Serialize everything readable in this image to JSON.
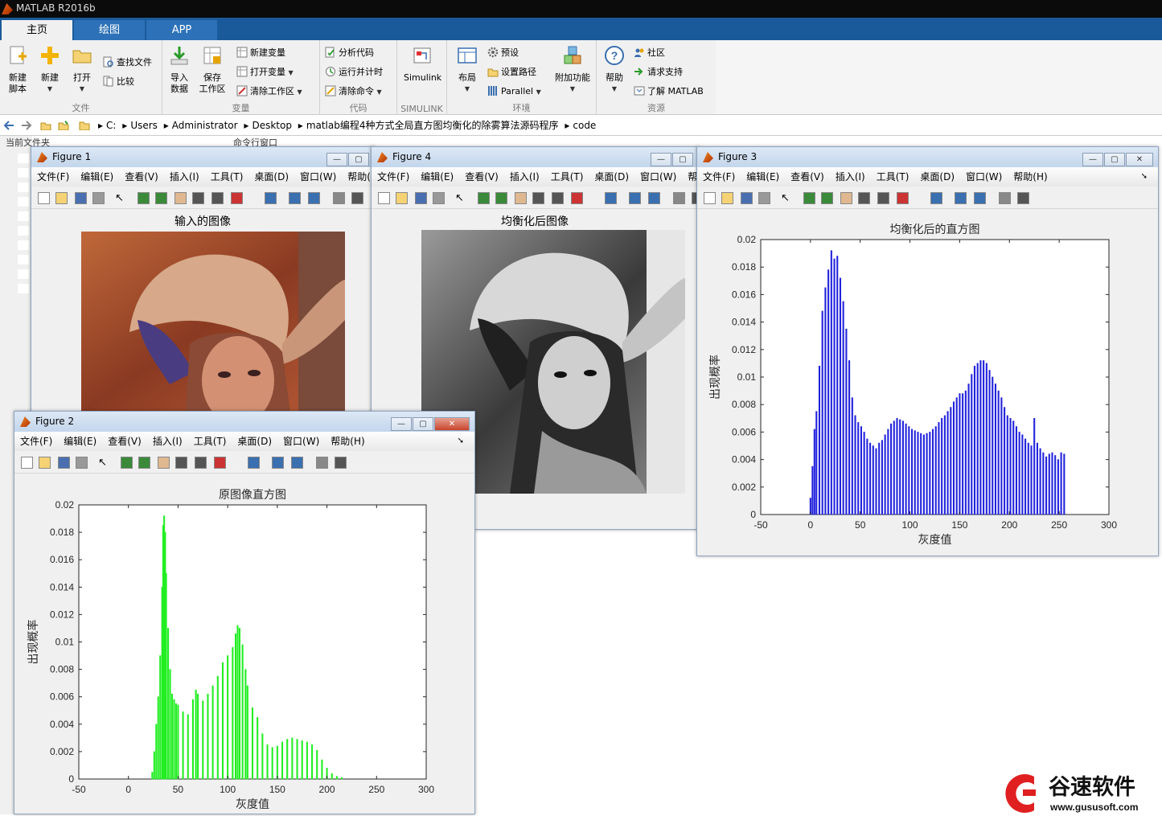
{
  "app": {
    "title": "MATLAB R2016b"
  },
  "tabs": [
    "主页",
    "绘图",
    "APP"
  ],
  "ribbon": {
    "file": {
      "label": "文件",
      "new_script": "新建\n脚本",
      "new": "新建",
      "open": "打开",
      "find_files": "查找文件",
      "compare": "比较"
    },
    "variable": {
      "label": "变量",
      "import": "导入\n数据",
      "save_ws": "保存\n工作区",
      "new_var": "新建变量",
      "open_var": "打开变量",
      "clear_ws": "清除工作区"
    },
    "code": {
      "label": "代码",
      "analyze": "分析代码",
      "run_time": "运行并计时",
      "clear_cmd": "清除命令"
    },
    "simulink": {
      "label": "SIMULINK",
      "simulink": "Simulink"
    },
    "env": {
      "label": "环境",
      "layout": "布局",
      "prefs": "预设",
      "set_path": "设置路径",
      "parallel": "Parallel",
      "addons": "附加功能"
    },
    "resources": {
      "label": "资源",
      "help": "帮助",
      "community": "社区",
      "support": "请求支持",
      "learn": "了解 MATLAB"
    }
  },
  "address": [
    "C:",
    "Users",
    "Administrator",
    "Desktop",
    "matlab编程4种方式全局直方图均衡化的除雾算法源码程序",
    "code"
  ],
  "panels": {
    "current_folder": "当前文件夹",
    "command_window": "命令行窗口"
  },
  "figure_menu": [
    "文件(F)",
    "编辑(E)",
    "查看(V)",
    "插入(I)",
    "工具(T)",
    "桌面(D)",
    "窗口(W)",
    "帮助(H)"
  ],
  "figures": {
    "fig1": {
      "title": "Figure 1",
      "plot_title": "输入的图像"
    },
    "fig4": {
      "title": "Figure 4",
      "plot_title": "均衡化后图像"
    },
    "fig3": {
      "title": "Figure 3",
      "plot_title": "均衡化后的直方图",
      "xlabel": "灰度值",
      "ylabel": "出现概率"
    },
    "fig2": {
      "title": "Figure 2",
      "plot_title": "原图像直方图",
      "xlabel": "灰度值",
      "ylabel": "出现概率"
    }
  },
  "watermark": {
    "name": "谷速软件",
    "url": "www.gususoft.com"
  },
  "chart_data": [
    {
      "type": "bar",
      "title": "原图像直方图",
      "xlabel": "灰度值",
      "ylabel": "出现概率",
      "xlim": [
        -50,
        300
      ],
      "ylim": [
        0,
        0.02
      ],
      "xticks": [
        -50,
        0,
        50,
        100,
        150,
        200,
        250,
        300
      ],
      "yticks": [
        0,
        0.002,
        0.004,
        0.006,
        0.008,
        0.01,
        0.012,
        0.014,
        0.016,
        0.018,
        0.02
      ],
      "color": "#22ee22",
      "x": [
        24,
        26,
        28,
        30,
        32,
        34,
        35,
        36,
        37,
        38,
        40,
        42,
        44,
        46,
        48,
        50,
        55,
        60,
        65,
        68,
        70,
        75,
        80,
        85,
        90,
        95,
        100,
        105,
        108,
        110,
        112,
        115,
        118,
        120,
        125,
        130,
        135,
        140,
        145,
        150,
        155,
        160,
        165,
        170,
        175,
        180,
        185,
        190,
        195,
        200,
        205,
        210,
        215
      ],
      "values": [
        0.0005,
        0.002,
        0.004,
        0.006,
        0.009,
        0.014,
        0.0185,
        0.0192,
        0.018,
        0.015,
        0.011,
        0.008,
        0.0062,
        0.0058,
        0.0055,
        0.0054,
        0.0049,
        0.0047,
        0.0058,
        0.0065,
        0.0062,
        0.0057,
        0.0062,
        0.0068,
        0.0075,
        0.0085,
        0.009,
        0.0096,
        0.0106,
        0.0112,
        0.011,
        0.0098,
        0.008,
        0.0068,
        0.0052,
        0.0045,
        0.0033,
        0.0025,
        0.0023,
        0.0024,
        0.0027,
        0.0029,
        0.003,
        0.0029,
        0.0028,
        0.0027,
        0.0025,
        0.0021,
        0.0014,
        0.0008,
        0.0004,
        0.0002,
        0.0001
      ]
    },
    {
      "type": "bar",
      "title": "均衡化后的直方图",
      "xlabel": "灰度值",
      "ylabel": "出现概率",
      "xlim": [
        -50,
        300
      ],
      "ylim": [
        0,
        0.02
      ],
      "xticks": [
        -50,
        0,
        50,
        100,
        150,
        200,
        250,
        300
      ],
      "yticks": [
        0,
        0.002,
        0.004,
        0.006,
        0.008,
        0.01,
        0.012,
        0.014,
        0.016,
        0.018,
        0.02
      ],
      "color": "#2222dd",
      "x": [
        0,
        2,
        4,
        6,
        9,
        12,
        15,
        18,
        21,
        24,
        27,
        30,
        33,
        36,
        39,
        42,
        45,
        48,
        51,
        54,
        57,
        60,
        63,
        66,
        69,
        72,
        75,
        78,
        81,
        84,
        87,
        90,
        93,
        96,
        99,
        102,
        105,
        108,
        111,
        114,
        117,
        120,
        123,
        126,
        129,
        132,
        135,
        138,
        141,
        144,
        147,
        150,
        153,
        156,
        159,
        162,
        165,
        168,
        171,
        174,
        177,
        180,
        183,
        186,
        189,
        192,
        195,
        198,
        201,
        204,
        207,
        210,
        213,
        216,
        219,
        222,
        225,
        228,
        231,
        234,
        237,
        240,
        243,
        246,
        249,
        252,
        255
      ],
      "values": [
        0.0012,
        0.0035,
        0.0062,
        0.0075,
        0.0108,
        0.0148,
        0.0165,
        0.0178,
        0.0192,
        0.0186,
        0.0188,
        0.0172,
        0.0155,
        0.0135,
        0.0112,
        0.0085,
        0.0072,
        0.0067,
        0.0064,
        0.006,
        0.0055,
        0.0052,
        0.005,
        0.0048,
        0.0052,
        0.0054,
        0.0058,
        0.0062,
        0.0066,
        0.0068,
        0.007,
        0.0069,
        0.0068,
        0.0066,
        0.0064,
        0.0062,
        0.0061,
        0.006,
        0.0059,
        0.0058,
        0.0059,
        0.006,
        0.0062,
        0.0064,
        0.0067,
        0.007,
        0.0072,
        0.0075,
        0.0078,
        0.0082,
        0.0085,
        0.0088,
        0.0088,
        0.009,
        0.0095,
        0.0102,
        0.0108,
        0.011,
        0.0112,
        0.0112,
        0.011,
        0.0105,
        0.01,
        0.0095,
        0.009,
        0.0085,
        0.0078,
        0.0072,
        0.007,
        0.0068,
        0.0064,
        0.006,
        0.0058,
        0.0055,
        0.0052,
        0.005,
        0.007,
        0.0052,
        0.0048,
        0.0045,
        0.0042,
        0.0044,
        0.0045,
        0.0043,
        0.004,
        0.0045,
        0.0044
      ]
    }
  ]
}
